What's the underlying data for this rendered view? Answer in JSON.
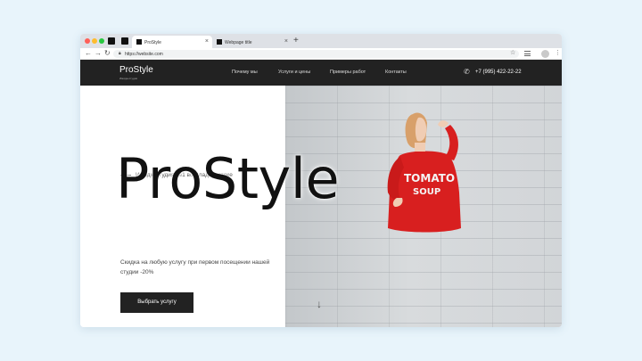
{
  "browser": {
    "tabs": [
      {
        "title": "ProStyle",
        "active": true
      },
      {
        "title": "Webpage title",
        "active": false
      }
    ],
    "url": "https://website.com"
  },
  "site": {
    "logo": "ProStyle",
    "logo_tagline": "Имидж-студия",
    "nav": [
      "Почему мы",
      "Услуги и цены",
      "Примеры работ",
      "Контакты"
    ],
    "phone": "+7 (995) 422-22-22"
  },
  "hero": {
    "eyebrow": "Имидж-студия №1 во Владивостоке",
    "title": "ProStyle",
    "description": "Скидка на любую услугу при первом посещении нашей студии -20%",
    "cta": "Выбрать услугу",
    "shirt_text_line1": "TOMATO",
    "shirt_text_line2": "SOUP"
  },
  "colors": {
    "page_bg": "#e8f4fb",
    "header_bg": "#222222",
    "accent_red": "#d91f1f"
  }
}
